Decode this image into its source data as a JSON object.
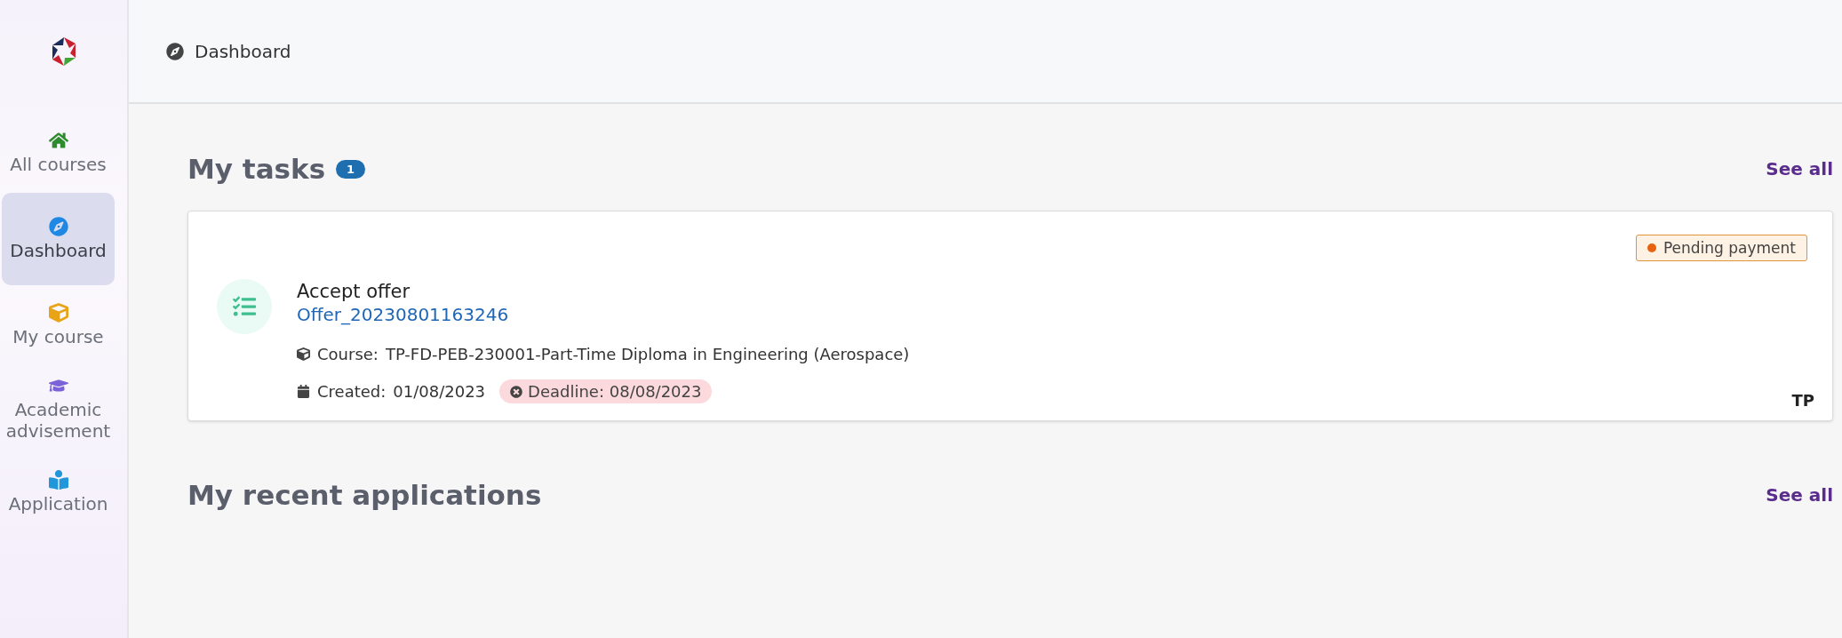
{
  "breadcrumb": "Dashboard",
  "sidebar": {
    "items": [
      {
        "label": "All courses",
        "selected": false
      },
      {
        "label": "Dashboard",
        "selected": true
      },
      {
        "label": "My course",
        "selected": false
      },
      {
        "label": "Academic advisement",
        "selected": false
      },
      {
        "label": "Application",
        "selected": false
      }
    ]
  },
  "tasks": {
    "title": "My tasks",
    "count": "1",
    "see_all": "See all",
    "cards": [
      {
        "status": "Pending payment",
        "title": "Accept offer",
        "link": "Offer_20230801163246",
        "course_label": "Course:",
        "course": "TP-FD-PEB-230001-Part-Time Diploma in Engineering (Aerospace)",
        "created_label": "Created:",
        "created": "01/08/2023",
        "deadline": "Deadline: 08/08/2023",
        "tag": "TP"
      }
    ]
  },
  "recent": {
    "title": "My recent applications",
    "see_all": "See all"
  }
}
